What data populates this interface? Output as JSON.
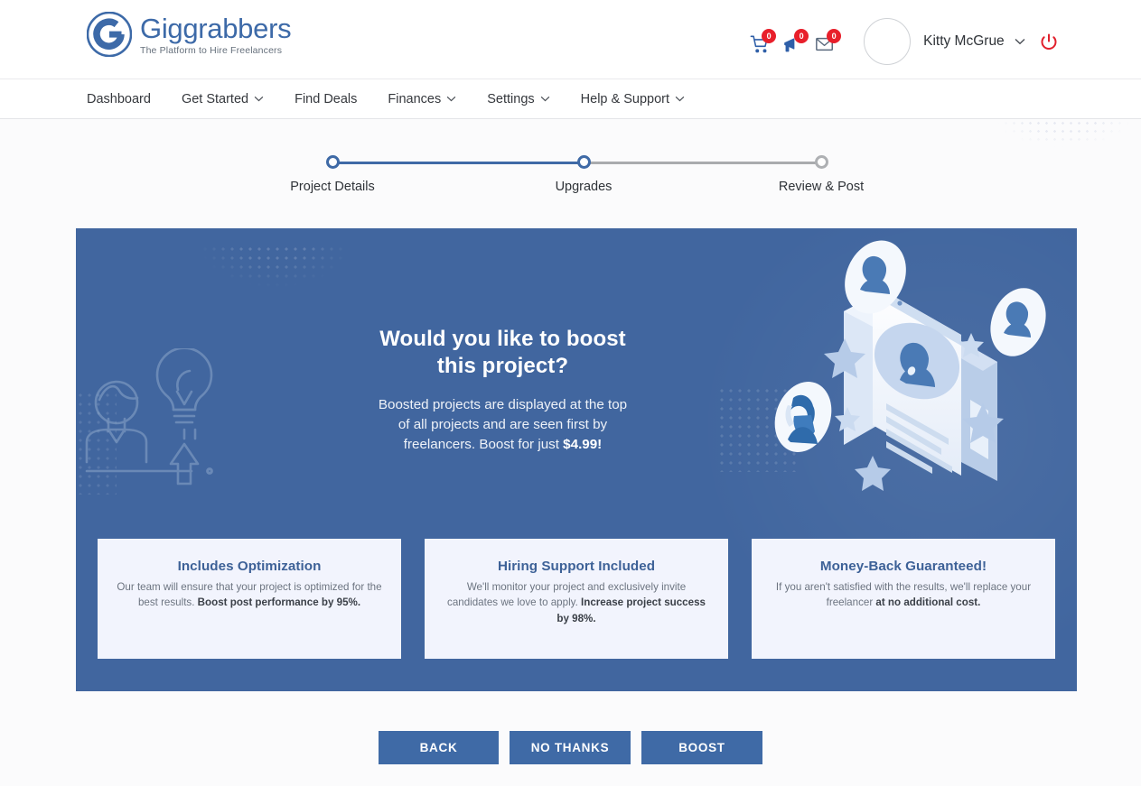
{
  "brand": {
    "name": "Giggrabbers",
    "tagline": "The Platform to Hire Freelancers",
    "logo_color": "#3d6aa8"
  },
  "header": {
    "notifications": [
      {
        "icon": "shopping-cart-icon",
        "count": "0"
      },
      {
        "icon": "bell-icon",
        "count": "0"
      },
      {
        "icon": "envelope-icon",
        "count": "0"
      }
    ],
    "user_name": "Kitty McGrue",
    "logout_icon": "power-icon",
    "badge_color": "#e81f2b",
    "logout_color": "#e1202c"
  },
  "nav": {
    "items": [
      {
        "label": "Dashboard",
        "has_caret": false
      },
      {
        "label": "Get Started",
        "has_caret": true
      },
      {
        "label": "Find Deals",
        "has_caret": false
      },
      {
        "label": "Finances",
        "has_caret": true
      },
      {
        "label": "Settings",
        "has_caret": true
      },
      {
        "label": "Help & Support",
        "has_caret": true
      }
    ]
  },
  "stepper": {
    "steps": [
      {
        "label": "Project Details",
        "state": "complete"
      },
      {
        "label": "Upgrades",
        "state": "current"
      },
      {
        "label": "Review & Post",
        "state": "upcoming"
      }
    ],
    "active_color": "#3f6aa6",
    "inactive_color": "#a9abae"
  },
  "hero": {
    "background_color": "#41669f",
    "title_line1": "Would you like to boost",
    "title_line2": "this project?",
    "subtitle_line1": "Boosted projects are displayed at the top",
    "subtitle_line2": "of all projects and are seen first by",
    "subtitle_line3_pre": "freelancers. Boost for just ",
    "price": "$4.99!",
    "left_illustration": "person-lightbulb-growth-icon",
    "right_illustration": "isometric-profile-boost-illustration"
  },
  "cards": [
    {
      "title": "Includes Optimization",
      "body_pre": "Our team will ensure that your project is optimized for the best results. ",
      "body_bold": "Boost post performance by 95%."
    },
    {
      "title": "Hiring Support Included",
      "body_pre": "We'll monitor your project and exclusively invite candidates we love to apply. ",
      "body_bold": "Increase project success by 98%."
    },
    {
      "title": "Money-Back Guaranteed!",
      "body_pre": "If you aren't satisfied with the results, we'll replace your freelancer ",
      "body_bold": "at no additional cost."
    }
  ],
  "actions": {
    "back": "BACK",
    "no_thanks": "NO THANKS",
    "boost": "BOOST",
    "button_color": "#3f6aa6"
  }
}
